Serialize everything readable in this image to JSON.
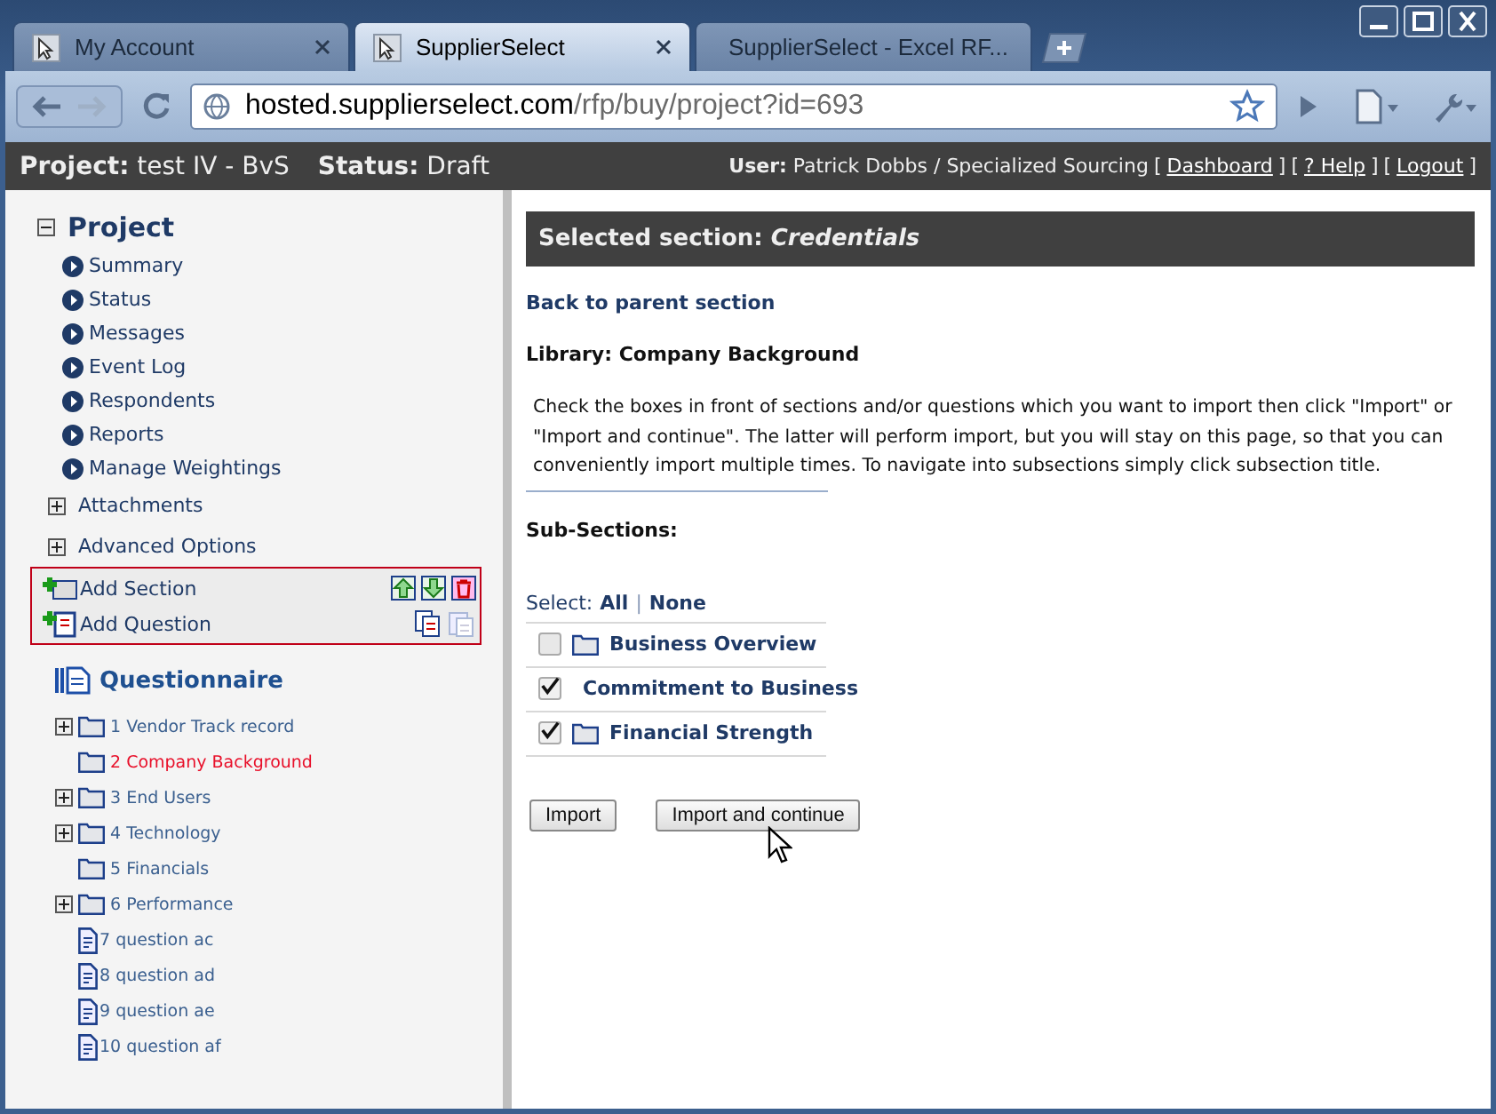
{
  "browser": {
    "tabs": [
      {
        "title": "My Account",
        "selected": false
      },
      {
        "title": "SupplierSelect",
        "selected": true
      },
      {
        "title": "SupplierSelect - Excel RF...",
        "selected": false
      }
    ],
    "url_host": "hosted.supplierselect.com",
    "url_path": "/rfp/buy/project?id=693"
  },
  "header": {
    "project_label": "Project:",
    "project": "test IV - BvS",
    "status_label": "Status:",
    "status": "Draft",
    "user_label": "User:",
    "user": "Patrick Dobbs / Specialized Sourcing",
    "links": [
      {
        "open": "[",
        "label": "Dashboard",
        "close": "]"
      },
      {
        "open": "[",
        "label": "? Help",
        "close": "]"
      },
      {
        "open": "[",
        "label": "Logout",
        "close": "]"
      }
    ]
  },
  "sidebar": {
    "project": {
      "title": "Project",
      "expanded": true,
      "items": [
        "Summary",
        "Status",
        "Messages",
        "Event Log",
        "Respondents",
        "Reports",
        "Manage Weightings"
      ]
    },
    "groups": [
      {
        "label": "Attachments",
        "expanded": false
      },
      {
        "label": "Advanced Options",
        "expanded": false
      }
    ],
    "actions": [
      "Add Section",
      "Add Question"
    ],
    "questionnaire": {
      "title": "Questionnaire",
      "items": [
        {
          "label": "1 Vendor Track record",
          "kind": "folder-collapsed",
          "selected": false
        },
        {
          "label": "2 Company Background",
          "kind": "folder",
          "selected": true
        },
        {
          "label": "3 End Users",
          "kind": "folder-collapsed",
          "selected": false
        },
        {
          "label": "4 Technology",
          "kind": "folder-collapsed",
          "selected": false
        },
        {
          "label": "5 Financials",
          "kind": "folder",
          "selected": false
        },
        {
          "label": "6 Performance",
          "kind": "folder-collapsed",
          "selected": false
        },
        {
          "label": "7 question ac",
          "kind": "question",
          "selected": false
        },
        {
          "label": "8 question ad",
          "kind": "question",
          "selected": false
        },
        {
          "label": "9 question ae",
          "kind": "question",
          "selected": false
        },
        {
          "label": "10 question af",
          "kind": "question",
          "selected": false
        }
      ]
    }
  },
  "main": {
    "title": "Selected section: *Credentials*",
    "back_link": "Back to parent section",
    "library": "Library: Company Background",
    "instructions": "Check the boxes in front of sections and/or questions which you want to import then click \"Import\" or \"Import and continue\". The latter will perform import, but you will stay on this page, so that you can conveniently import multiple times. To navigate into subsections simply click subsection title.",
    "subsections_label": "Sub-Sections:",
    "select_label": "Select:",
    "select_all": "All",
    "select_separator": "|",
    "select_none": "None",
    "subsections": [
      {
        "title": "Business Overview",
        "checked": false
      },
      {
        "title": "Commitment to Business",
        "checked": true
      },
      {
        "title": "Financial Strength",
        "checked": true
      }
    ],
    "buttons": [
      "Import",
      "Import and continue"
    ]
  }
}
